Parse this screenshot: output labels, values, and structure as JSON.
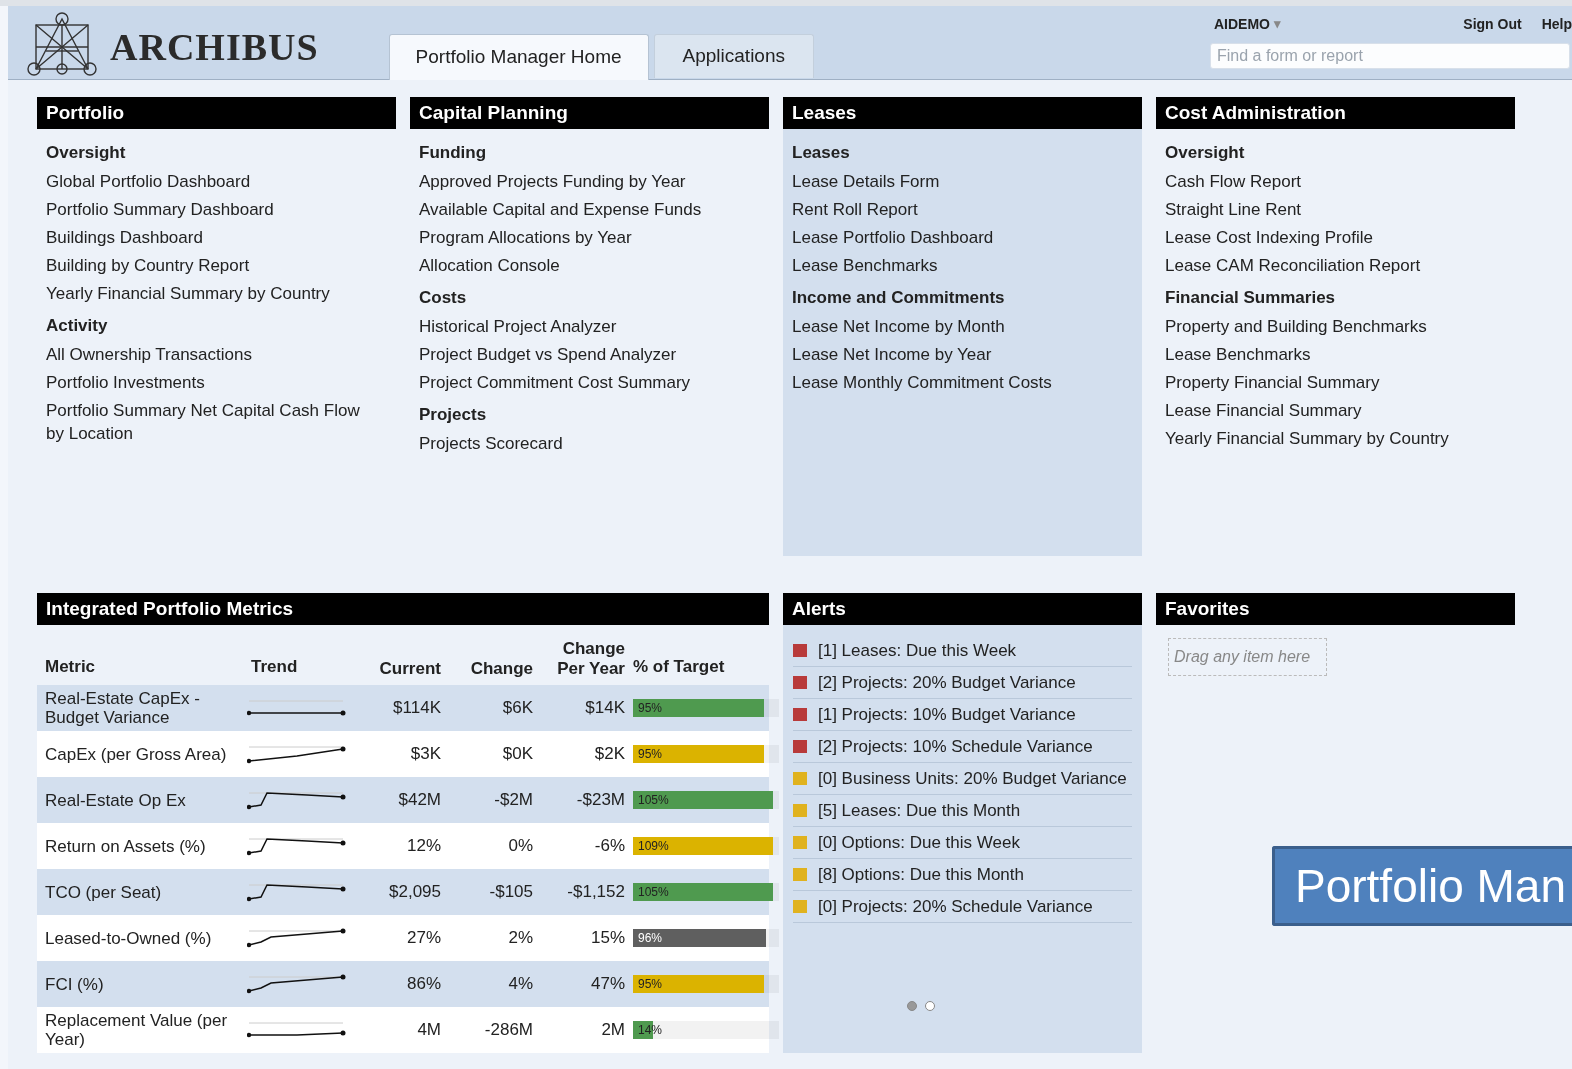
{
  "header": {
    "logo_text": "ARCHIBUS",
    "tabs": [
      {
        "label": "Portfolio Manager Home",
        "selected": true
      },
      {
        "label": "Applications",
        "selected": false
      }
    ],
    "user": "AIDEMO",
    "user_caret": "▾",
    "links": [
      "Sign Out",
      "Help"
    ],
    "search": {
      "placeholder": "Find a form or report"
    }
  },
  "columns": [
    {
      "title": "Portfolio",
      "highlighted": false,
      "groups": [
        {
          "heading": "Oversight",
          "items": [
            "Global Portfolio Dashboard",
            "Portfolio Summary Dashboard",
            "Buildings Dashboard",
            "Building by Country Report",
            "Yearly Financial Summary by Country"
          ]
        },
        {
          "heading": "Activity",
          "items": [
            "All Ownership Transactions",
            "Portfolio Investments",
            "Portfolio Summary Net Capital Cash Flow by Location"
          ]
        }
      ]
    },
    {
      "title": "Capital Planning",
      "highlighted": false,
      "groups": [
        {
          "heading": "Funding",
          "items": [
            "Approved Projects Funding by Year",
            "Available Capital and Expense Funds",
            "Program Allocations by Year",
            "Allocation Console"
          ]
        },
        {
          "heading": "Costs",
          "items": [
            "Historical Project Analyzer",
            "Project Budget vs Spend Analyzer",
            "Project Commitment Cost Summary"
          ]
        },
        {
          "heading": "Projects",
          "items": [
            "Projects Scorecard"
          ]
        }
      ]
    },
    {
      "title": "Leases",
      "highlighted": true,
      "groups": [
        {
          "heading": "Leases",
          "items": [
            "Lease Details Form",
            "Rent Roll Report",
            "Lease Portfolio Dashboard",
            "Lease Benchmarks"
          ]
        },
        {
          "heading": "Income and Commitments",
          "items": [
            "Lease Net Income by Month",
            "Lease Net Income by Year",
            "Lease Monthly Commitment Costs"
          ]
        }
      ]
    },
    {
      "title": "Cost Administration",
      "highlighted": false,
      "groups": [
        {
          "heading": "Oversight",
          "items": [
            "Cash Flow Report",
            "Straight Line Rent",
            "Lease Cost Indexing Profile",
            "Lease CAM Reconciliation Report"
          ]
        },
        {
          "heading": "Financial Summaries",
          "items": [
            "Property and Building Benchmarks",
            "Lease Benchmarks",
            "Property Financial Summary",
            "Lease Financial Summary",
            "Yearly Financial Summary by Country"
          ]
        }
      ]
    }
  ],
  "metrics": {
    "title": "Integrated Portfolio Metrics",
    "columns": [
      "Metric",
      "Trend",
      "Current",
      "Change",
      "Change Per Year",
      "% of Target"
    ],
    "rows": [
      {
        "metric": "Real-Estate CapEx - Budget Variance",
        "current": "$114K",
        "change": "$6K",
        "per_year": "$14K",
        "target": "95%",
        "level": 0.9,
        "color": "#4f9a4f"
      },
      {
        "metric": "CapEx (per Gross Area)",
        "current": "$3K",
        "change": "$0K",
        "per_year": "$2K",
        "target": "95%",
        "level": 0.9,
        "color": "#dbb300"
      },
      {
        "metric": "Real-Estate Op Ex",
        "current": "$42M",
        "change": "-$2M",
        "per_year": "-$23M",
        "target": "105%",
        "level": 0.96,
        "color": "#4f9a4f"
      },
      {
        "metric": "Return on Assets (%)",
        "current": "12%",
        "change": "0%",
        "per_year": "-6%",
        "target": "109%",
        "level": 0.96,
        "color": "#dbb300"
      },
      {
        "metric": "TCO (per Seat)",
        "current": "$2,095",
        "change": "-$105",
        "per_year": "-$1,152",
        "target": "105%",
        "level": 0.96,
        "color": "#4f9a4f"
      },
      {
        "metric": "Leased-to-Owned (%)",
        "current": "27%",
        "change": "2%",
        "per_year": "15%",
        "target": "96%",
        "level": 0.91,
        "color": "#5f5f5f"
      },
      {
        "metric": "FCI (%)",
        "current": "86%",
        "change": "4%",
        "per_year": "47%",
        "target": "95%",
        "level": 0.9,
        "color": "#dbb300"
      },
      {
        "metric": "Replacement Value (per Year)",
        "current": "4M",
        "change": "-286M",
        "per_year": "2M",
        "target": "14%",
        "level": 0.14,
        "color": "#4f9a4f"
      }
    ]
  },
  "alerts": {
    "title": "Alerts",
    "items": [
      {
        "text": "[1] Leases: Due this Week",
        "color": "#b83a3a"
      },
      {
        "text": "[2] Projects: 20% Budget Variance",
        "color": "#b83a3a"
      },
      {
        "text": "[1] Projects: 10% Budget Variance",
        "color": "#b83a3a"
      },
      {
        "text": "[2] Projects: 10% Schedule Variance",
        "color": "#b83a3a"
      },
      {
        "text": "[0] Business Units: 20% Budget Variance",
        "color": "#e0b21e"
      },
      {
        "text": "[5] Leases: Due this Month",
        "color": "#e0b21e"
      },
      {
        "text": "[0] Options: Due this Week",
        "color": "#e0b21e"
      },
      {
        "text": "[8] Options: Due this Month",
        "color": "#e0b21e"
      },
      {
        "text": "[0] Projects: 20% Schedule Variance",
        "color": "#e0b21e"
      }
    ],
    "pages": [
      {
        "selected": true
      },
      {
        "selected": false
      }
    ]
  },
  "favorites": {
    "title": "Favorites",
    "placeholder": "Drag any item here"
  },
  "overlay_banner": "Portfolio Man"
}
